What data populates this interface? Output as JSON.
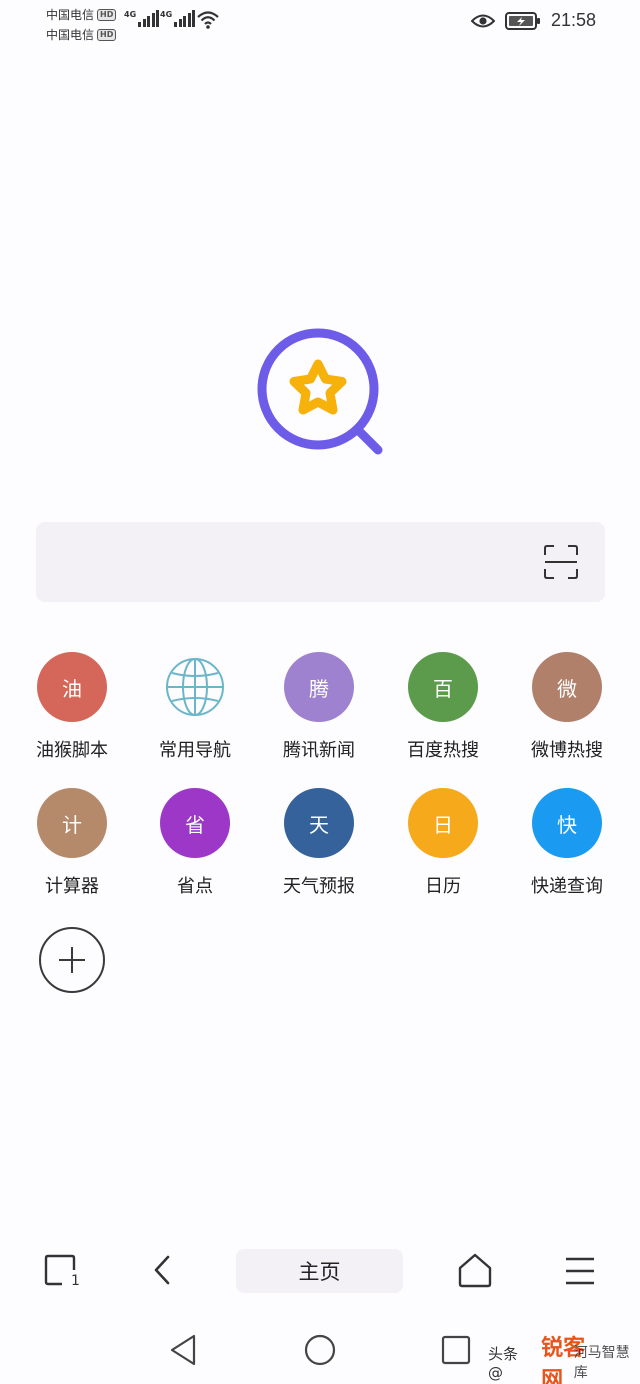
{
  "status_bar": {
    "carrier_1": "中国电信",
    "carrier_2": "中国电信",
    "hd_label": "HD",
    "network_1": "4G",
    "network_2": "4G",
    "time": "21:58"
  },
  "search": {
    "placeholder": ""
  },
  "shortcuts": [
    {
      "icon_text": "油",
      "label": "油猴脚本",
      "color": "#d5675a"
    },
    {
      "icon_text": "",
      "label": "常用导航",
      "color": "#6bb6c9"
    },
    {
      "icon_text": "腾",
      "label": "腾讯新闻",
      "color": "#9e82cf"
    },
    {
      "icon_text": "百",
      "label": "百度热搜",
      "color": "#5c9a4c"
    },
    {
      "icon_text": "微",
      "label": "微博热搜",
      "color": "#b0806b"
    },
    {
      "icon_text": "计",
      "label": "计算器",
      "color": "#b48a6a"
    },
    {
      "icon_text": "省",
      "label": "省点",
      "color": "#9c37c8"
    },
    {
      "icon_text": "天",
      "label": "天气预报",
      "color": "#35629a"
    },
    {
      "icon_text": "日",
      "label": "日历",
      "color": "#f6a91a"
    },
    {
      "icon_text": "快",
      "label": "快递查询",
      "color": "#1a9af0"
    }
  ],
  "toolbar": {
    "tab_count": "1",
    "home_label": "主页"
  },
  "watermark": {
    "prefix": "头条 @",
    "brand": "锐客网",
    "suffix": "河马智慧库"
  },
  "colors": {
    "logo_ring": "#6c5ce7",
    "logo_star": "#f6b10a",
    "background": "#fdfcfe",
    "search_bg": "#f3f1f5"
  }
}
